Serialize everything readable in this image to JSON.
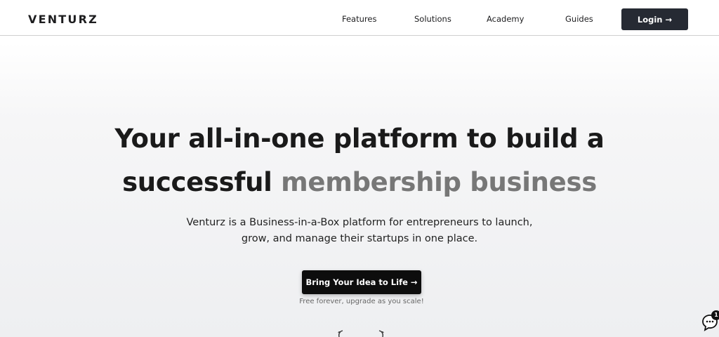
{
  "header": {
    "logo": "VENTURZ",
    "nav": {
      "features": "Features",
      "solutions": "Solutions",
      "academy": "Academy",
      "guides": "Guides"
    },
    "login_label": "Login →"
  },
  "hero": {
    "title_line1": "Your all-in-one platform to build a",
    "title_line2_dark": "successful",
    "title_line2_muted": "membership business",
    "subtitle_line1": "Venturz is a Business-in-a-Box platform for entrepreneurs to launch,",
    "subtitle_line2": "grow, and manage their startups in one place.",
    "cta_label": "Bring Your Idea to Life →",
    "cta_note": "Free forever, upgrade as you scale!"
  },
  "chat": {
    "badge_count": "1",
    "icon": "chat-bubble-icon"
  },
  "colors": {
    "login_bg": "#262a33",
    "cta_bg": "#0d0d0d",
    "title_dark": "#1a1a1a",
    "title_muted": "#777777"
  }
}
